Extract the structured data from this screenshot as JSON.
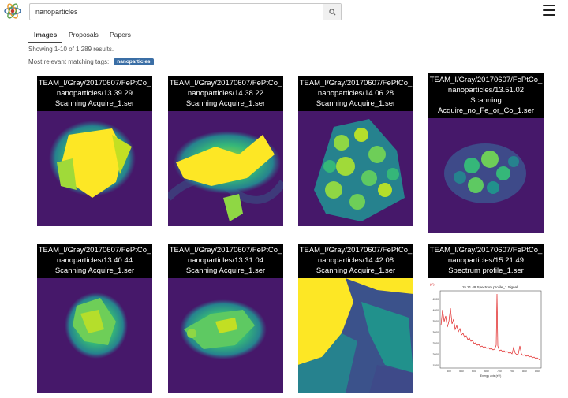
{
  "header": {
    "search_value": "nanoparticles"
  },
  "tabs": [
    {
      "label": "Images"
    },
    {
      "label": "Proposals"
    },
    {
      "label": "Papers"
    }
  ],
  "results_text": "Showing 1-10 of 1,289 results.",
  "tags_label": "Most relevant matching tags:",
  "tag": "nanoparticles",
  "icons": {
    "search": "search-icon",
    "menu": "hamburger-menu-icon",
    "logo": "atom-logo-icon"
  },
  "colors": {
    "accent": "#3a6ea5",
    "viridis_dark": "#46186a",
    "viridis_bright": "#f8e51e"
  },
  "cards": [
    {
      "caption": "TEAM_I/Gray/20170607/FePtCo_\nnanoparticles/13.39.29\nScanning Acquire_1.ser"
    },
    {
      "caption": "TEAM_I/Gray/20170607/FePtCo_\nnanoparticles/14.38.22\nScanning Acquire_1.ser"
    },
    {
      "caption": "TEAM_I/Gray/20170607/FePtCo_\nnanoparticles/14.06.28\nScanning Acquire_1.ser"
    },
    {
      "caption": "TEAM_I/Gray/20170607/FePtCo_\nnanoparticles/13.51.02\nScanning\nAcquire_no_Fe_or_Co_1.ser"
    },
    {
      "caption": "TEAM_I/Gray/20170607/FePtCo_\nnanoparticles/13.40.44\nScanning Acquire_1.ser"
    },
    {
      "caption": "TEAM_I/Gray/20170607/FePtCo_\nnanoparticles/13.31.04\nScanning Acquire_1.ser"
    },
    {
      "caption": "TEAM_I/Gray/20170607/FePtCo_\nnanoparticles/14.42.08\nScanning Acquire_1.ser"
    },
    {
      "caption": "TEAM_I/Gray/20170607/FePtCo_\nnanoparticles/15.21.49\nSpectrum profile_1.ser"
    }
  ],
  "spectrum_plot": {
    "title": "15.21.49 Spectrum profile_1 Signal",
    "xlabel": "Energy axis (eV)",
    "corner_label": "(C)",
    "y_ticks": [
      "4500",
      "4000",
      "3500",
      "3000",
      "2500",
      "2000",
      "1500"
    ],
    "x_ticks": [
      "500",
      "550",
      "600",
      "650",
      "700",
      "750",
      "800",
      "850"
    ]
  }
}
